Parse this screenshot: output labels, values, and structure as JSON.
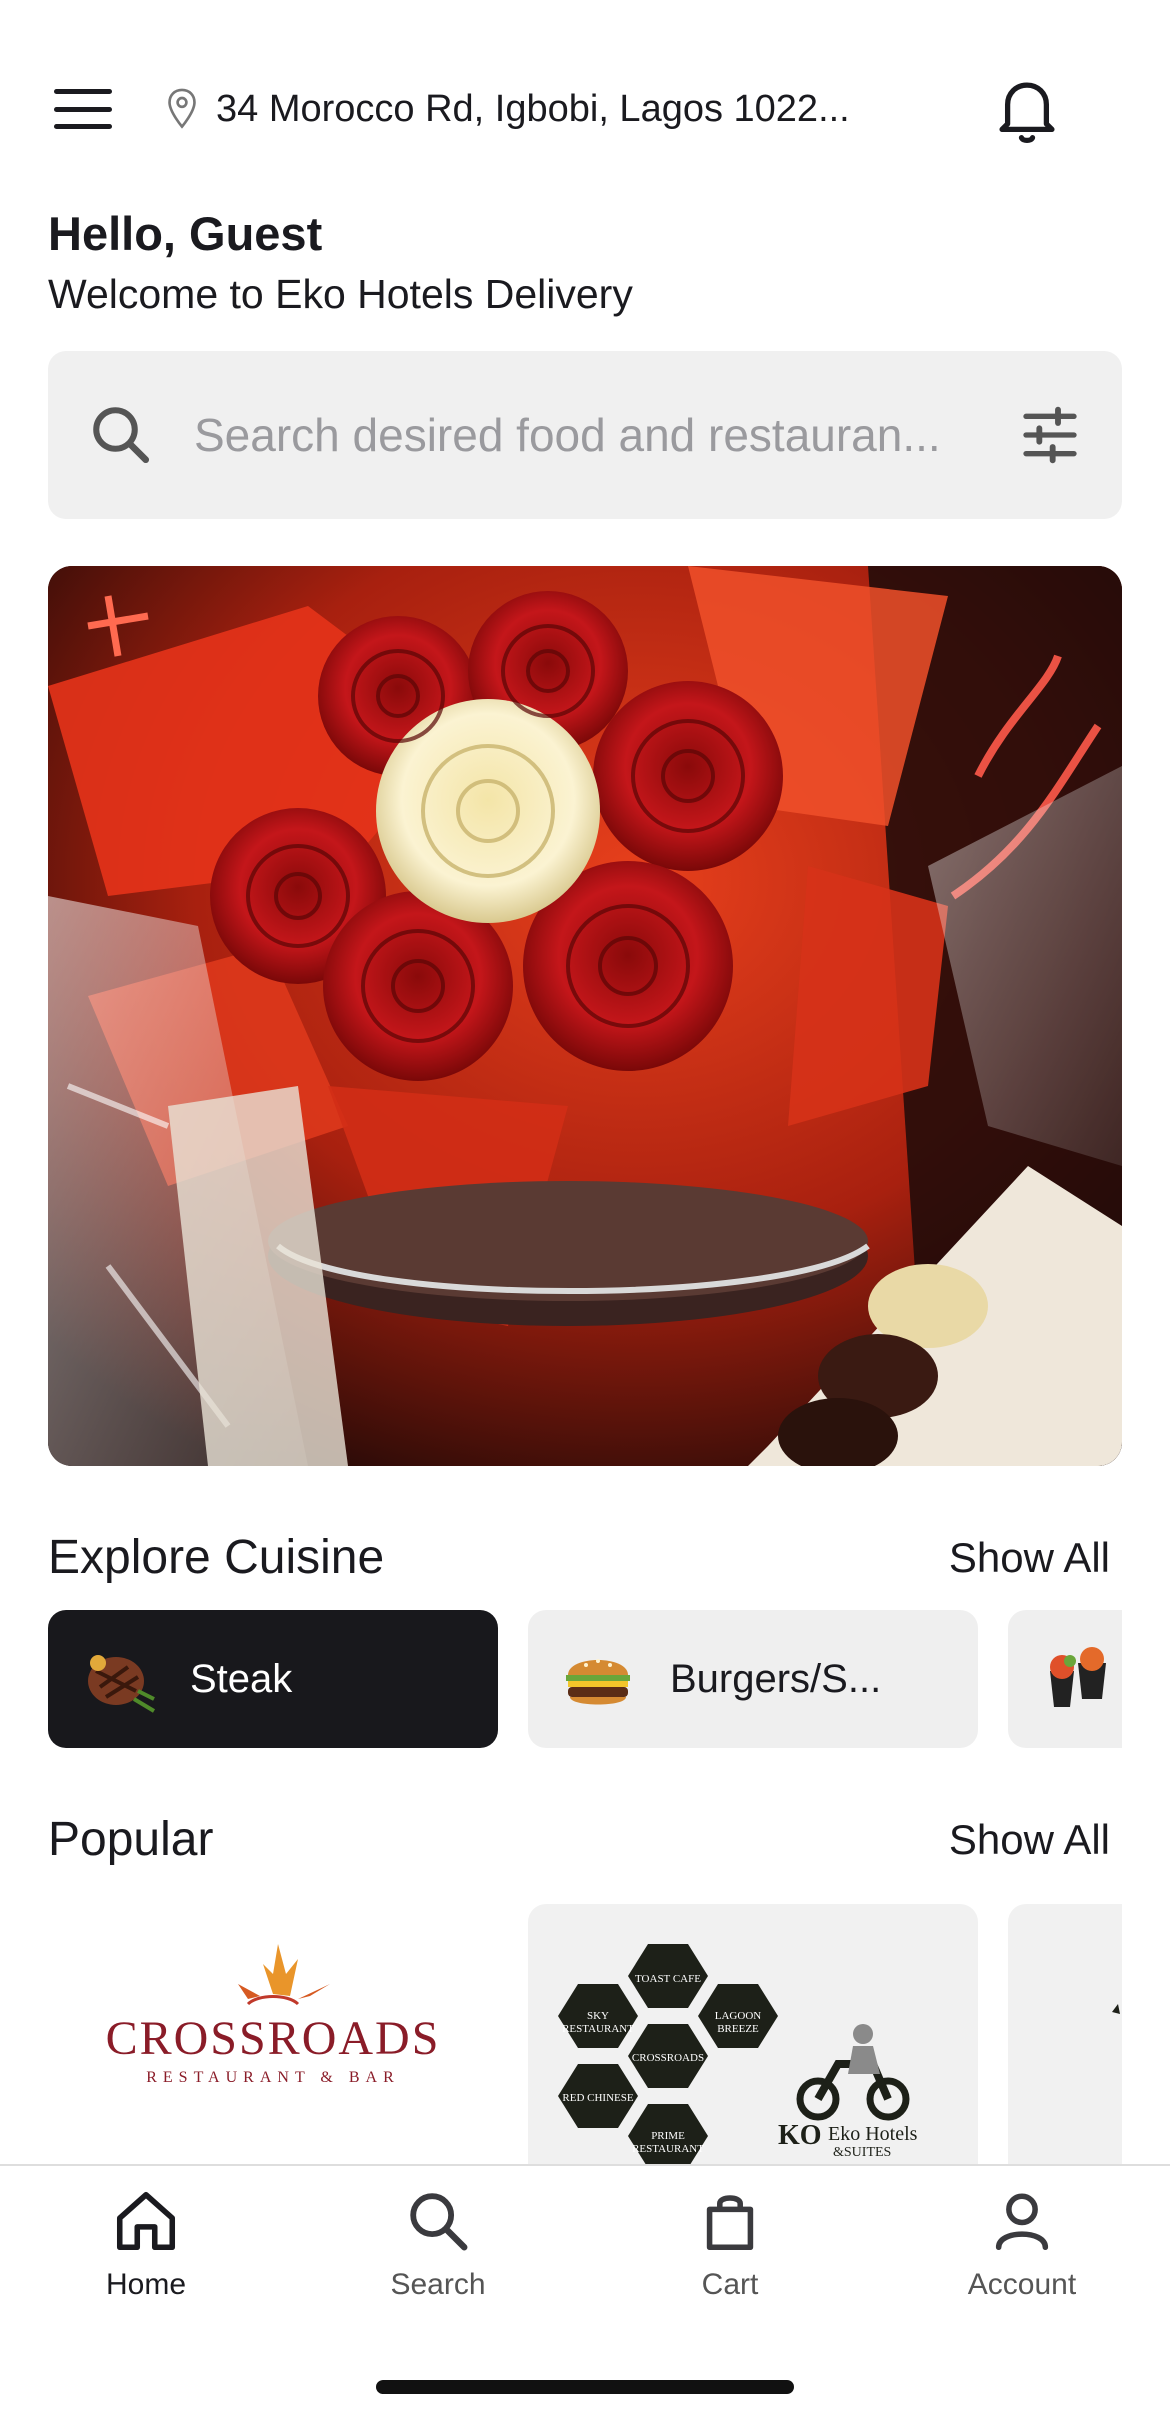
{
  "header": {
    "address": "34 Morocco Rd, Igbobi, Lagos 1022...",
    "menu_icon": "hamburger-menu-icon",
    "location_icon": "map-pin-icon",
    "notification_icon": "bell-icon"
  },
  "greeting": {
    "hello": "Hello, Guest",
    "welcome": "Welcome to Eko Hotels Delivery"
  },
  "search": {
    "placeholder": "Search desired food and restauran...",
    "search_icon": "magnifier-icon",
    "filter_icon": "sliders-icon"
  },
  "banner": {
    "description_icon": "promo-banner-image"
  },
  "explore": {
    "title": "Explore Cuisine",
    "show_all": "Show All",
    "items": [
      {
        "label": "Steak",
        "active": true
      },
      {
        "label": "Burgers/S...",
        "active": false
      },
      {
        "label": "",
        "active": false
      }
    ]
  },
  "popular": {
    "title": "Popular",
    "show_all": "Show All",
    "cards": [
      {
        "logo_text": "CROSSROADS",
        "logo_sub": "RESTAURANT & BAR"
      },
      {
        "hex_labels": [
          "TOAST CAFE",
          "SKY RESTAURANT",
          "LAGOON BREEZE",
          "CROSSROADS",
          "RED CHINESE",
          "PRIME RESTAURANT"
        ],
        "brand": "Eko Hotels & Suites"
      }
    ]
  },
  "bottom_nav": {
    "items": [
      {
        "label": "Home",
        "icon": "home-icon",
        "active": true
      },
      {
        "label": "Search",
        "icon": "search-icon",
        "active": false
      },
      {
        "label": "Cart",
        "icon": "shopping-bag-icon",
        "active": false
      },
      {
        "label": "Account",
        "icon": "user-icon",
        "active": false
      }
    ]
  },
  "colors": {
    "primary_dark": "#18181c",
    "chip_inactive": "#efefef",
    "search_bg": "#f0f0f0",
    "placeholder": "#9a9a9e"
  }
}
